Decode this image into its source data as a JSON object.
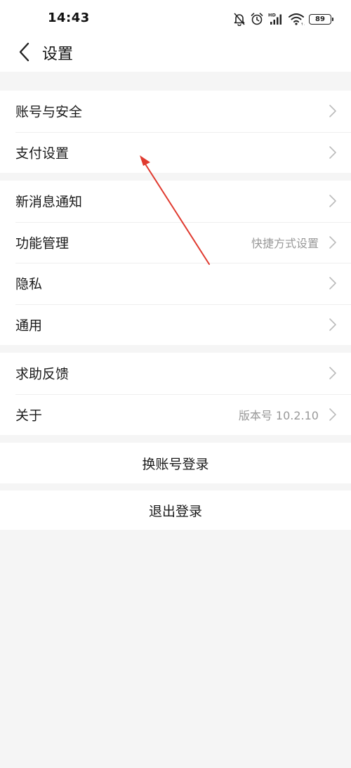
{
  "status_bar": {
    "time": "14:43",
    "battery": "89",
    "icons": [
      "bell-muted-icon",
      "alarm-icon",
      "hd-signal-icon",
      "wifi-icon",
      "battery-icon"
    ]
  },
  "header": {
    "back_icon": "chevron-left-icon",
    "title": "设置"
  },
  "groups": [
    {
      "items": [
        {
          "label": "账号与安全",
          "value": ""
        },
        {
          "label": "支付设置",
          "value": ""
        }
      ]
    },
    {
      "items": [
        {
          "label": "新消息通知",
          "value": ""
        },
        {
          "label": "功能管理",
          "value": "快捷方式设置"
        },
        {
          "label": "隐私",
          "value": ""
        },
        {
          "label": "通用",
          "value": ""
        }
      ]
    },
    {
      "items": [
        {
          "label": "求助反馈",
          "value": ""
        },
        {
          "label": "关于",
          "value": "版本号 10.2.10"
        }
      ]
    }
  ],
  "actions": {
    "switch_account": "换账号登录",
    "logout": "退出登录"
  },
  "colors": {
    "background": "#f5f5f5",
    "surface": "#ffffff",
    "secondary_text": "#999999",
    "annotation_arrow": "#e03a2f"
  }
}
